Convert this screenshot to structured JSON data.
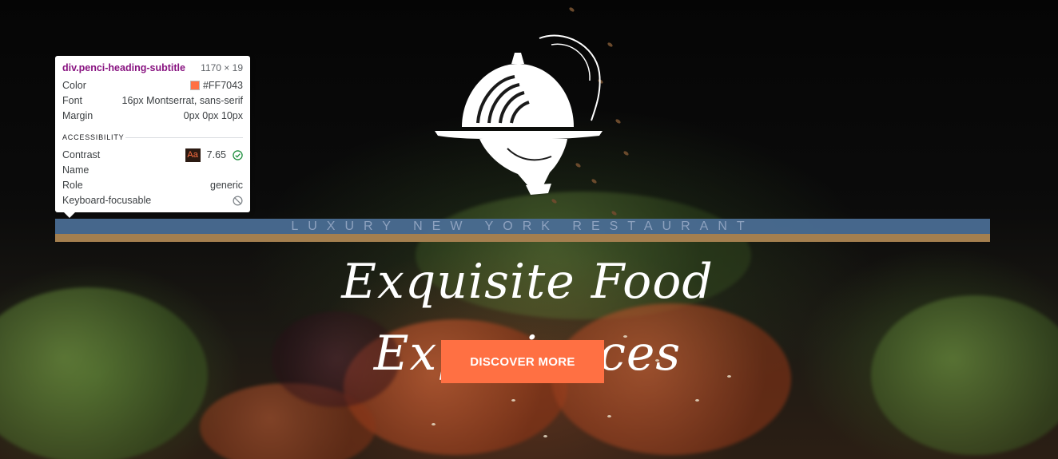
{
  "hero": {
    "subtitle": "LUXURY NEW YORK RESTAURANT",
    "title": "Exquisite Food Experiences",
    "button_label": "DISCOVER MORE",
    "logo_icon": "cloche-serving-tray-icon",
    "accent_color": "#FF7043"
  },
  "inspector": {
    "selector": "div.penci-heading-subtitle",
    "dimensions": "1170 × 19",
    "rows": [
      {
        "label": "Color",
        "value": "#FF7043"
      },
      {
        "label": "Font",
        "value": "16px Montserrat, sans-serif"
      },
      {
        "label": "Margin",
        "value": "0px 0px 10px"
      }
    ],
    "section_title": "ACCESSIBILITY",
    "accessibility": [
      {
        "label": "Contrast",
        "value": "7.65",
        "badge": "Aa",
        "icon": "check-circle-icon"
      },
      {
        "label": "Name",
        "value": ""
      },
      {
        "label": "Role",
        "value": "generic"
      },
      {
        "label": "Keyboard-focusable",
        "value": "",
        "icon": "not-allowed-icon"
      }
    ]
  }
}
